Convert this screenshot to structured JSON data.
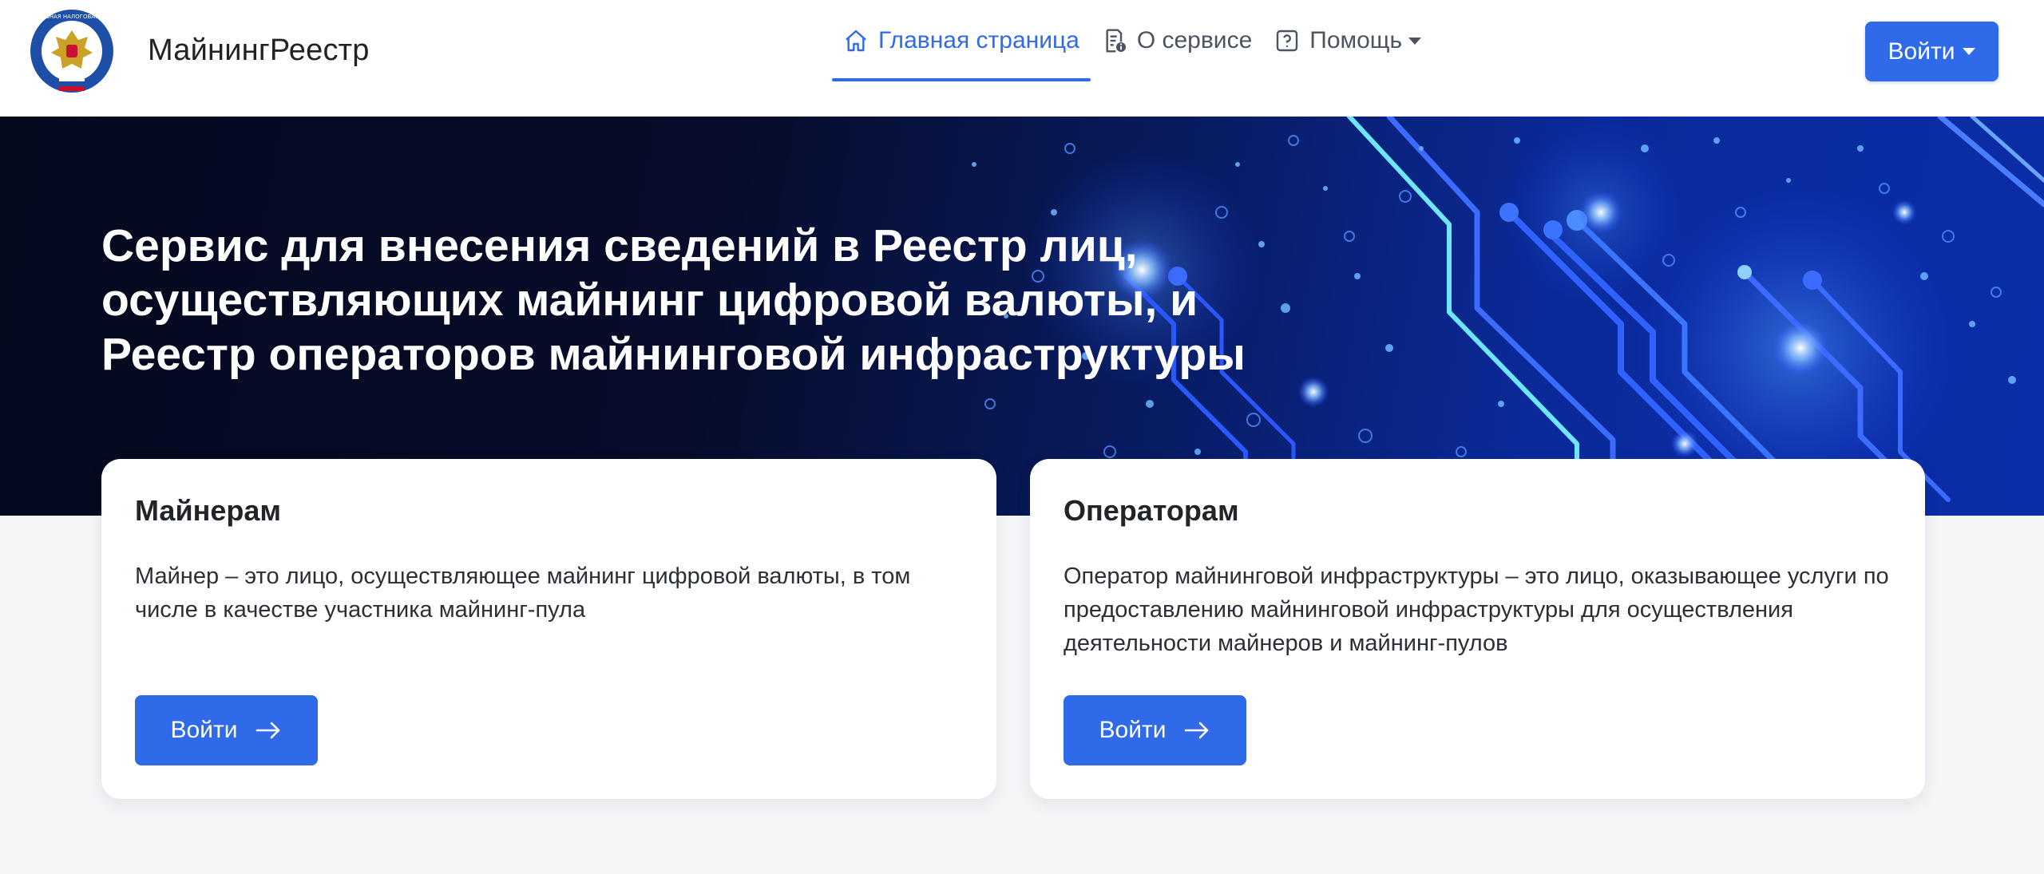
{
  "header": {
    "brand": "МайнингРеестр",
    "logo_text": "ФЕДЕРАЛЬНАЯ НАЛОГОВАЯ СЛУЖБА",
    "nav": [
      {
        "label": "Главная страница",
        "icon": "home-icon",
        "active": true
      },
      {
        "label": "О сервисе",
        "icon": "document-info-icon",
        "active": false
      },
      {
        "label": "Помощь",
        "icon": "help-icon",
        "active": false,
        "dropdown": true
      }
    ],
    "login_label": "Войти"
  },
  "hero": {
    "title": "Сервис для внесения сведений в Реестр лиц, осуществляющих майнинг цифровой валюты, и Реестр операторов майнинговой инфраструктуры"
  },
  "cards": [
    {
      "title": "Майнерам",
      "text": "Майнер – это лицо, осуществляющее майнинг цифровой валюты, в том числе в качестве участника майнинг-пула",
      "button": "Войти"
    },
    {
      "title": "Операторам",
      "text": "Оператор майнинговой инфраструктуры – это лицо, оказывающее услуги по предоставлению майнинговой инфраструктуры для осуществления деятельности майнеров и майнинг-пулов",
      "button": "Войти"
    }
  ],
  "colors": {
    "accent": "#2f6ae9",
    "hero_dark": "#05091e",
    "hero_blue": "#0a2ea8",
    "page_bg": "#f4f5f7"
  }
}
